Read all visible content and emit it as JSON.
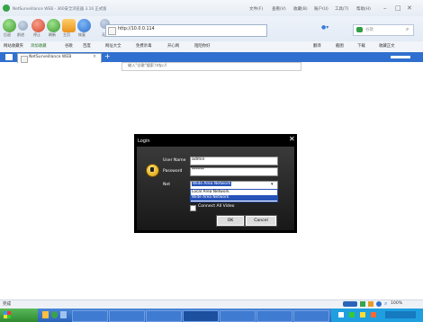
{
  "window": {
    "title": "NetSurveillance WEB - 360安全浏览器 3.16 正式版",
    "menu": [
      "文件(F)",
      "查看(V)",
      "收藏(B)",
      "账户(U)",
      "工具(T)",
      "帮助(H)"
    ]
  },
  "toolbar": {
    "nav_labels": [
      "后退",
      "前进",
      "停止",
      "刷新",
      "主页",
      "恢复",
      "无痕"
    ],
    "address": "http://10.0.0.114",
    "search_placeholder": "谷歌"
  },
  "favorites": {
    "items": [
      "网站收藏夹",
      "添加收藏",
      "谷歌",
      "百度",
      "网址大全",
      "免费杀毒",
      "开心网",
      "陌陌你好"
    ],
    "right_items": [
      "翻译",
      "截图",
      "下载",
      "收藏正文"
    ]
  },
  "tab": {
    "label": "NetSurveillance WEB"
  },
  "page": {
    "hint": "输入\"谷歌\"搜索 http://"
  },
  "login": {
    "title": "Login",
    "user_label": "User Name",
    "user_value": "admin",
    "password_label": "Password",
    "password_value": "******",
    "net_label": "Net",
    "net_selected": "Wide Area Network",
    "net_options": [
      "Local Area Network",
      "Wide Area Network"
    ],
    "checkbox_label": "Connect All Video",
    "ok": "OK",
    "cancel": "Cancel"
  },
  "status": {
    "text": "完成",
    "zoom": "100%"
  },
  "colors": {
    "accent": "#2753b8",
    "tabbar": "#2f6fcf",
    "dialog": "#000000"
  }
}
